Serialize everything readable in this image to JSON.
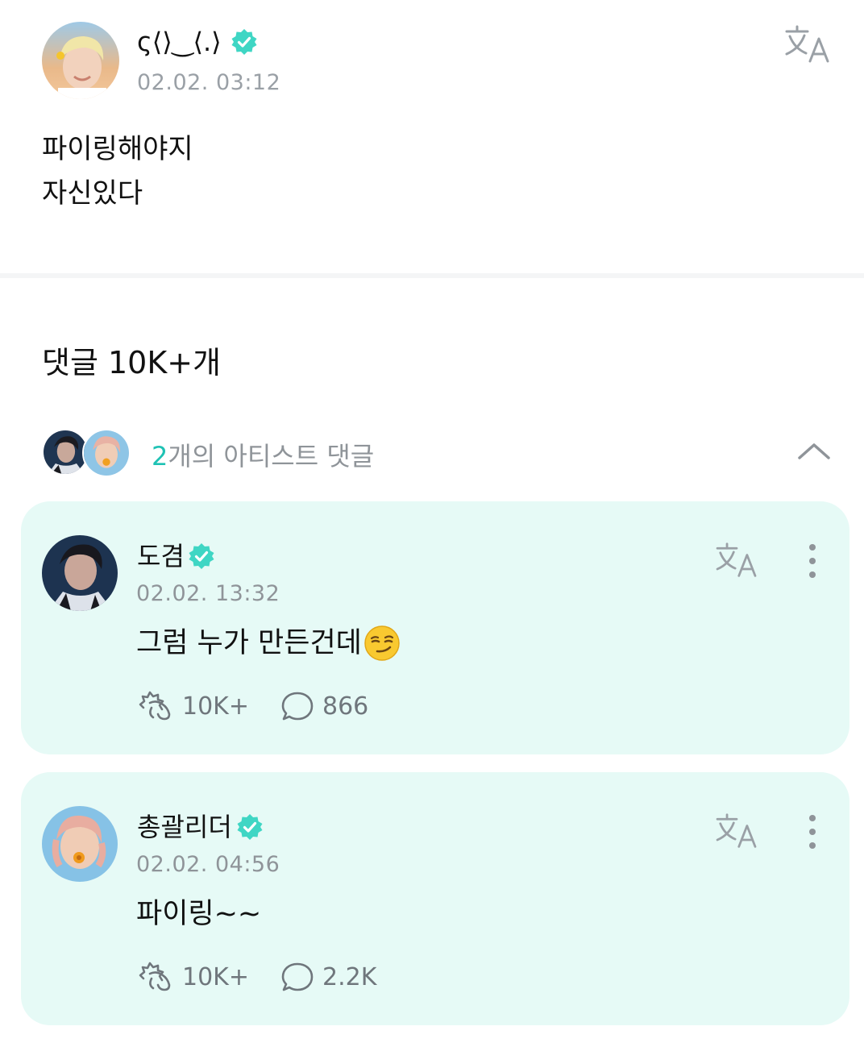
{
  "post": {
    "author_name": "ʕ(ᐛ)‿(ᐛ)ʔ",
    "author_name_display": "ς⟨⟩‿⟨.⟩",
    "timestamp": "02.02. 03:12",
    "lines": [
      "파이링해야지",
      "자신있다"
    ]
  },
  "comments_header": {
    "title": "댓글 10K+개"
  },
  "artist_comments": {
    "count": "2",
    "label_suffix": "개의 아티스트 댓글"
  },
  "cards": [
    {
      "name": "도겸",
      "timestamp": "02.02. 13:32",
      "text": "그럼 누가 만든건데",
      "emoji": "smirk-face",
      "likes": "10K+",
      "replies": "866"
    },
    {
      "name": "총괄리더",
      "timestamp": "02.02. 04:56",
      "text": "파이링~~",
      "likes": "10K+",
      "replies": "2.2K"
    }
  ],
  "colors": {
    "accent": "#1fc2b4",
    "verified": "#3fd6c4",
    "card_bg": "#e6faf6",
    "muted_text": "#8f9499"
  },
  "icons": [
    "translate-icon",
    "verified-badge-icon",
    "chevron-up-icon",
    "more-vertical-icon",
    "cheer-icon",
    "comment-bubble-icon"
  ]
}
